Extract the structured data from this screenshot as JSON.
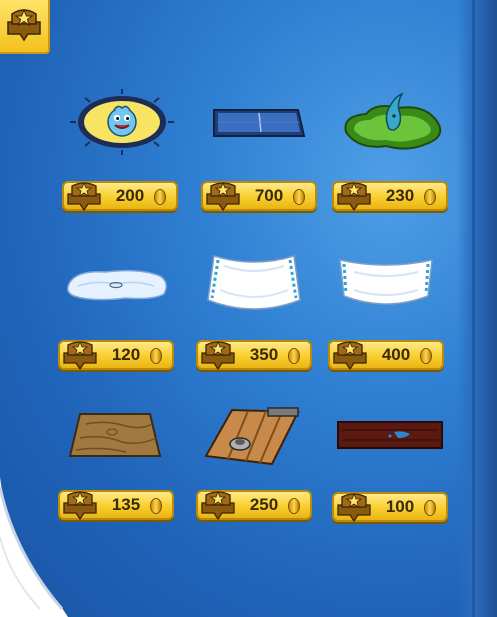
{
  "catalog": {
    "items": [
      {
        "name": "puffle-rug",
        "price": "200"
      },
      {
        "name": "blue-mat",
        "price": "700"
      },
      {
        "name": "green-puddle",
        "price": "230"
      },
      {
        "name": "ice-patch",
        "price": "120"
      },
      {
        "name": "white-curtain-a",
        "price": "350"
      },
      {
        "name": "white-curtain-b",
        "price": "400"
      },
      {
        "name": "wood-mat",
        "price": "135"
      },
      {
        "name": "wood-trapdoor",
        "price": "250"
      },
      {
        "name": "dark-plank",
        "price": "100"
      }
    ]
  },
  "colors": {
    "page_blue": "#2f7fd2",
    "tag_gold": "#f8cf2e",
    "tag_border": "#b98a0c"
  },
  "icons": {
    "corner": "star-badge-icon",
    "tag": "coin-badge-icon",
    "coin": "coin-icon"
  }
}
